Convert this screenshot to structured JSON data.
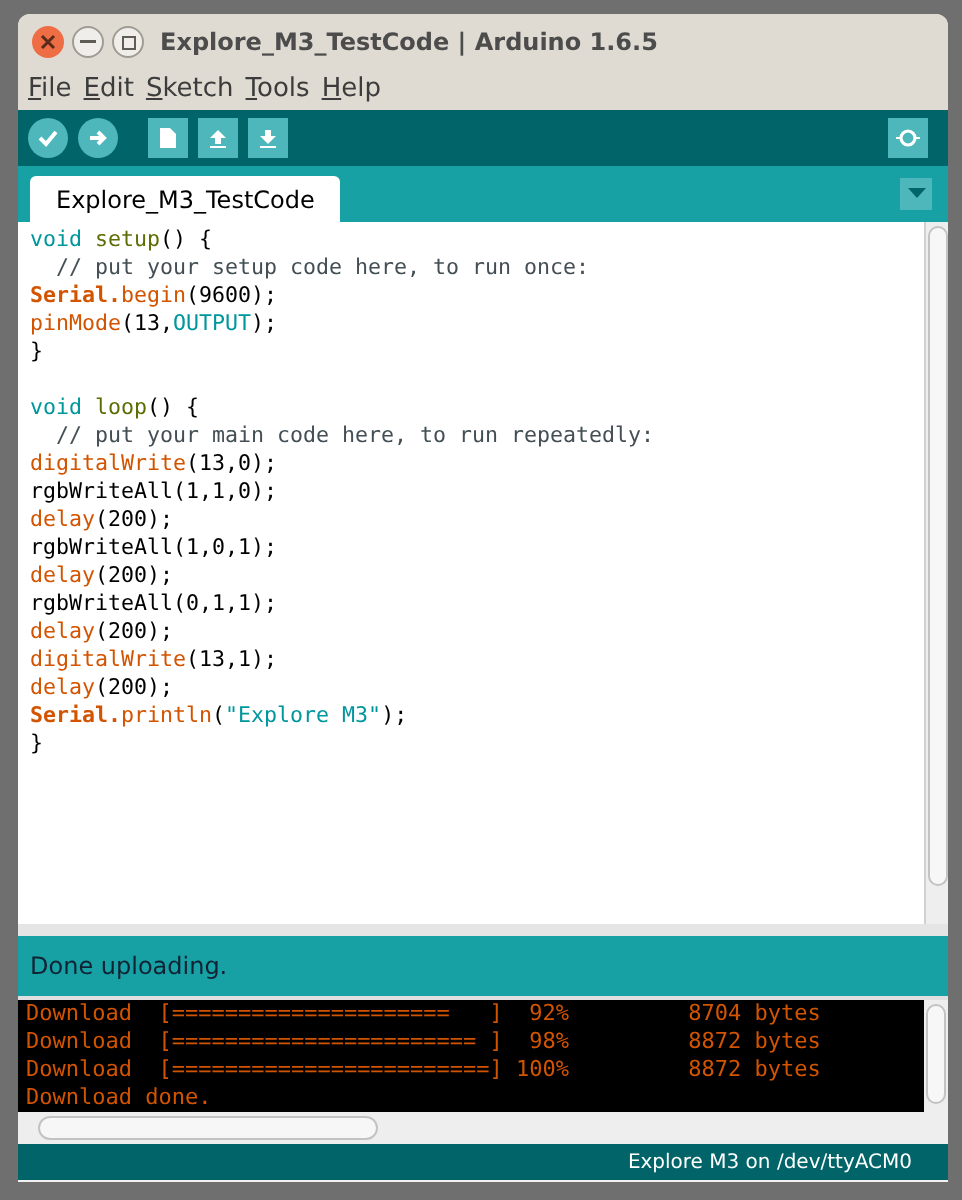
{
  "window": {
    "title": "Explore_M3_TestCode | Arduino 1.6.5"
  },
  "menu": [
    "File",
    "Edit",
    "Sketch",
    "Tools",
    "Help"
  ],
  "tabs": [
    {
      "label": "Explore_M3_TestCode",
      "selected": true
    }
  ],
  "code": [
    [
      {
        "text": "void ",
        "kind": "keyword"
      },
      {
        "text": "setup",
        "kind": "function"
      },
      {
        "text": "() {",
        "kind": "plain"
      }
    ],
    [
      {
        "text": "  // put your setup code here, to run once:",
        "kind": "comment"
      }
    ],
    [
      {
        "text": "Serial.",
        "kind": "object"
      },
      {
        "text": "begin",
        "kind": "call"
      },
      {
        "text": "(9600);",
        "kind": "plain"
      }
    ],
    [
      {
        "text": "pinMode",
        "kind": "call"
      },
      {
        "text": "(13,",
        "kind": "plain"
      },
      {
        "text": "OUTPUT",
        "kind": "constant"
      },
      {
        "text": ");",
        "kind": "plain"
      }
    ],
    [
      {
        "text": "}",
        "kind": "plain"
      }
    ],
    [
      {
        "text": "void ",
        "kind": "keyword",
        "gap_before": true
      },
      {
        "text": "loop",
        "kind": "function"
      },
      {
        "text": "() {",
        "kind": "plain"
      }
    ],
    [
      {
        "text": "  // put your main code here, to run repeatedly:",
        "kind": "comment"
      }
    ],
    [
      {
        "text": "digitalWrite",
        "kind": "call"
      },
      {
        "text": "(13,0);",
        "kind": "plain"
      }
    ],
    [
      {
        "text": "rgbWriteAll(1,1,0);",
        "kind": "plain"
      }
    ],
    [
      {
        "text": "delay",
        "kind": "call"
      },
      {
        "text": "(200);",
        "kind": "plain"
      }
    ],
    [
      {
        "text": "rgbWriteAll(1,0,1);",
        "kind": "plain"
      }
    ],
    [
      {
        "text": "delay",
        "kind": "call"
      },
      {
        "text": "(200);",
        "kind": "plain"
      }
    ],
    [
      {
        "text": "rgbWriteAll(0,1,1);",
        "kind": "plain"
      }
    ],
    [
      {
        "text": "delay",
        "kind": "call"
      },
      {
        "text": "(200);",
        "kind": "plain"
      }
    ],
    [
      {
        "text": "digitalWrite",
        "kind": "call"
      },
      {
        "text": "(13,1);",
        "kind": "plain"
      }
    ],
    [
      {
        "text": "delay",
        "kind": "call"
      },
      {
        "text": "(200);",
        "kind": "plain"
      }
    ],
    [
      {
        "text": "Serial.",
        "kind": "object"
      },
      {
        "text": "println",
        "kind": "call"
      },
      {
        "text": "(",
        "kind": "plain"
      },
      {
        "text": "\"Explore M3\"",
        "kind": "string"
      },
      {
        "text": ");",
        "kind": "plain"
      }
    ],
    [
      {
        "text": "}",
        "kind": "plain"
      }
    ]
  ],
  "status": {
    "message": "Done uploading."
  },
  "console": [
    "Download  [=====================   ]  92%         8704 bytes",
    "Download  [======================= ]  98%         8872 bytes",
    "Download  [========================] 100%         8872 bytes",
    "Download done."
  ],
  "status_bar": {
    "board": "Explore M3 on /dev/ttyACM0"
  }
}
